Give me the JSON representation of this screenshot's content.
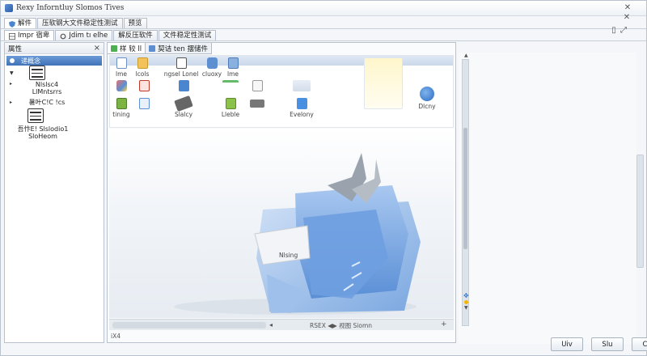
{
  "window": {
    "title": "Rexy Inforntluy Slomos Tives"
  },
  "tabs_row1": [
    {
      "label": "解件"
    },
    {
      "label": "压软钢大文件稳定性测试"
    },
    {
      "label": "预览"
    }
  ],
  "tabs_row2": [
    {
      "label": "Impr 宿卑"
    },
    {
      "label": "Jdim tı elhe"
    },
    {
      "label": "解反压软件"
    },
    {
      "label": "文件稳定性测试"
    }
  ],
  "left_panel": {
    "header": "属性",
    "close_glyph": "×",
    "selected_label": "递概念",
    "items": [
      {
        "label": "Nlslsc4\nLlMntsrrs"
      },
      {
        "label": "暑叶C!C !cs"
      },
      {
        "label": "吾忭E! Slslodio1\nSloHeom"
      }
    ]
  },
  "main_tabs": [
    {
      "label": "样 较 ll"
    },
    {
      "label": "契诘 ten 摆储件"
    }
  ],
  "ribbon": {
    "items": [
      {
        "label": "lme"
      },
      {
        "label": "lcols"
      },
      {
        "label": "ngsel Lonel"
      },
      {
        "label": "cluoxy"
      },
      {
        "label": "lme"
      },
      {
        "label": "tining"
      },
      {
        "label": "Slalcy"
      },
      {
        "label": "Lleble"
      },
      {
        "label": "Evelony"
      },
      {
        "label": "Dlcny"
      }
    ]
  },
  "canvas": {
    "card_label": "Nlsing"
  },
  "status": {
    "left": "iX4",
    "center": "RSEX ◀▶ 视图 Siomn",
    "plus": "+"
  },
  "buttons": [
    {
      "label": "Uiv"
    },
    {
      "label": "Slu"
    },
    {
      "label": "Cw"
    }
  ],
  "colors": {
    "accent": "#3f72b8",
    "folder_blue": "#7aa7e0"
  }
}
